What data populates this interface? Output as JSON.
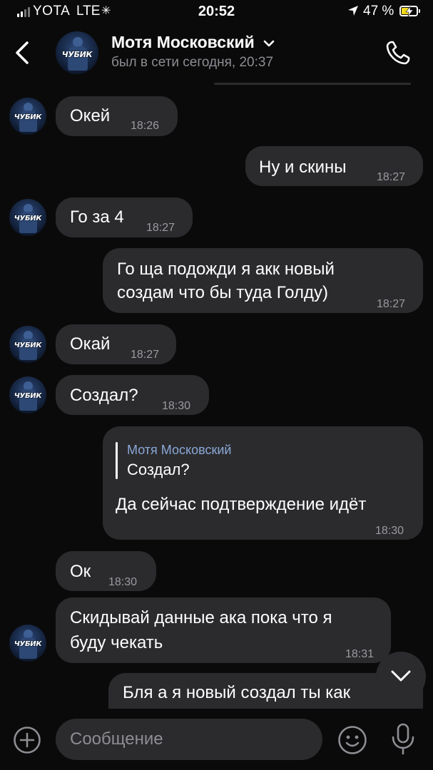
{
  "status_bar": {
    "carrier": "YOTA",
    "network": "LTE",
    "loading_glyph": "✳",
    "time": "20:52",
    "battery_percent": "47 %",
    "battery_level": 0.47,
    "battery_color": "#f1d81c"
  },
  "header": {
    "contact_name": "Мотя Московский",
    "last_seen": "был в сети сегодня, 20:37",
    "avatar_text": "ЧУБИК",
    "icons": [
      "back-chevron-icon",
      "chevron-down-icon",
      "phone-icon"
    ]
  },
  "messages": [
    {
      "direction": "in",
      "text": "Окей",
      "time": "18:26",
      "avatar_text": "ЧУБИК"
    },
    {
      "direction": "out",
      "text": "Ну и скины",
      "time": "18:27"
    },
    {
      "direction": "in",
      "text": "Го за 4",
      "time": "18:27",
      "avatar_text": "ЧУБИК"
    },
    {
      "direction": "out",
      "lines": [
        "Го ща подожди я акк новый",
        "создам что бы туда Голду)"
      ],
      "time": "18:27"
    },
    {
      "direction": "in",
      "text": "Окай",
      "time": "18:27",
      "avatar_text": "ЧУБИК"
    },
    {
      "direction": "in",
      "text": "Создал?",
      "time": "18:30",
      "avatar_text": "ЧУБИК"
    },
    {
      "direction": "out",
      "reply_to": {
        "name": "Мотя Московский",
        "text": "Создал?"
      },
      "text": "Да сейчас подтверждение идёт",
      "time": "18:30"
    },
    {
      "direction": "in",
      "text": "Ок",
      "time": "18:30"
    },
    {
      "direction": "in",
      "lines": [
        "Скидывай данные ака пока что я",
        "буду чекать"
      ],
      "time": "18:31",
      "avatar_text": "ЧУБИК"
    },
    {
      "direction": "out",
      "text": "Бля а я новый создал ты как",
      "partial": true
    }
  ],
  "input": {
    "placeholder": "Сообщение",
    "icons": [
      "plus-icon",
      "emoji-icon",
      "microphone-icon"
    ]
  },
  "colors": {
    "background": "#0a0a0a",
    "bubble": "#2b2b2e",
    "secondary_text": "#8d8d93",
    "reply_name": "#8aa8d6"
  }
}
